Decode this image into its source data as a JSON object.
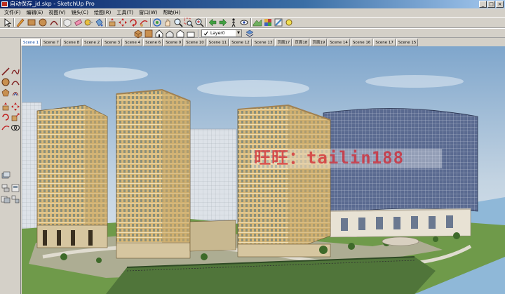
{
  "window": {
    "title": "自动保存_jd.skp - SketchUp Pro",
    "controls": [
      "_",
      "□",
      "×"
    ]
  },
  "menu": [
    "文件(F)",
    "编辑(E)",
    "视图(V)",
    "镜头(C)",
    "绘图(R)",
    "工具(T)",
    "窗口(W)",
    "帮助(H)"
  ],
  "toolbar": {
    "layer_value": "Layer0",
    "icons": [
      "select-icon",
      "pencil-icon",
      "rectangle-icon",
      "circle-icon",
      "arc-icon",
      "eraser-icon",
      "paint-bucket-icon",
      "push-pull-icon",
      "move-icon",
      "rotate-icon",
      "follow-me-icon",
      "offset-icon",
      "orbit-icon",
      "pan-icon",
      "zoom-icon",
      "zoom-window-icon",
      "zoom-extents-icon",
      "tape-measure-icon",
      "protractor-icon",
      "text-icon",
      "axes-icon",
      "dimension-icon",
      "section-icon",
      "component-icon",
      "materials-icon",
      "walk-icon"
    ]
  },
  "scenes": [
    "Scene 1",
    "Scene 7",
    "Scene 8",
    "Scene 2",
    "Scene 3",
    "Scene 4",
    "Scene 6",
    "Scene 9",
    "Scene 10",
    "Scene 11",
    "Scene 12",
    "Scene 13",
    "页面17",
    "页面18",
    "页面19",
    "Scene 14",
    "Scene 16",
    "Scene 17",
    "Scene 15"
  ],
  "active_scene": "Scene 1",
  "watermark": "旺旺：tailin188",
  "colors": {
    "sky_top": "#7fa6cc",
    "sky_bottom": "#dfe8ef",
    "building_tan": "#d8b878",
    "glass_tower": "#5a6a90",
    "lawn": "#6f9a4a",
    "water": "#8fb8d8",
    "watermark": "#d21e28"
  }
}
